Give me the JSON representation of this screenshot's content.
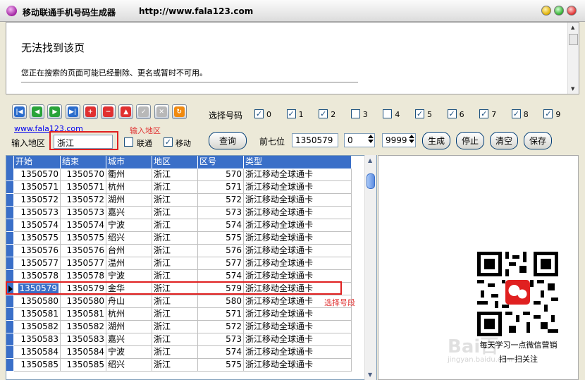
{
  "window": {
    "title": "移动联通手机号码生成器",
    "url": "http://www.fala123.com"
  },
  "web": {
    "heading": "无法找到该页",
    "message": "您正在搜索的页面可能已经删除、更名或暂时不可用。"
  },
  "toolbar": {
    "icons": [
      "first-icon",
      "prev-icon",
      "play-icon",
      "next-icon",
      "add-icon",
      "remove-icon",
      "up-icon",
      "check-icon",
      "clear-icon",
      "refresh-icon"
    ],
    "icon_glyphs": [
      "|◀",
      "◀",
      "▶",
      "▶|",
      "+",
      "−",
      "▲",
      "✓",
      "✕",
      "↻"
    ]
  },
  "select_number": {
    "label": "选择号码",
    "digits": [
      {
        "label": "0",
        "checked": true
      },
      {
        "label": "1",
        "checked": true
      },
      {
        "label": "2",
        "checked": true
      },
      {
        "label": "3",
        "checked": false
      },
      {
        "label": "4",
        "checked": false
      },
      {
        "label": "5",
        "checked": true
      },
      {
        "label": "6",
        "checked": true
      },
      {
        "label": "7",
        "checked": true
      },
      {
        "label": "8",
        "checked": true
      },
      {
        "label": "9",
        "checked": true
      }
    ]
  },
  "link": "www.fala123.com",
  "annotations": {
    "input_region": "输入地区",
    "select_segment": "选择号段"
  },
  "form": {
    "region_label": "输入地区",
    "region_value": "浙江",
    "unicom_label": "联通",
    "unicom_checked": false,
    "mobile_label": "移动",
    "mobile_checked": true,
    "query_button": "查询",
    "first7_label": "前七位",
    "first7_value": "1350579",
    "start_value": "0",
    "end_value": "9999",
    "generate_button": "生成",
    "stop_button": "停止",
    "clear_button": "清空",
    "save_button": "保存"
  },
  "table": {
    "columns": [
      "开始",
      "结束",
      "城市",
      "地区",
      "区号",
      "类型"
    ],
    "selected_row": 9,
    "rows": [
      [
        "1350570",
        "1350570",
        "衢州",
        "浙江",
        "570",
        "浙江移动全球通卡"
      ],
      [
        "1350571",
        "1350571",
        "杭州",
        "浙江",
        "571",
        "浙江移动全球通卡"
      ],
      [
        "1350572",
        "1350572",
        "湖州",
        "浙江",
        "572",
        "浙江移动全球通卡"
      ],
      [
        "1350573",
        "1350573",
        "嘉兴",
        "浙江",
        "573",
        "浙江移动全球通卡"
      ],
      [
        "1350574",
        "1350574",
        "宁波",
        "浙江",
        "574",
        "浙江移动全球通卡"
      ],
      [
        "1350575",
        "1350575",
        "绍兴",
        "浙江",
        "575",
        "浙江移动全球通卡"
      ],
      [
        "1350576",
        "1350576",
        "台州",
        "浙江",
        "576",
        "浙江移动全球通卡"
      ],
      [
        "1350577",
        "1350577",
        "温州",
        "浙江",
        "577",
        "浙江移动全球通卡"
      ],
      [
        "1350578",
        "1350578",
        "宁波",
        "浙江",
        "574",
        "浙江移动全球通卡"
      ],
      [
        "1350579",
        "1350579",
        "金华",
        "浙江",
        "579",
        "浙江移动全球通卡"
      ],
      [
        "1350580",
        "1350580",
        "舟山",
        "浙江",
        "580",
        "浙江移动全球通卡"
      ],
      [
        "1350581",
        "1350581",
        "杭州",
        "浙江",
        "571",
        "浙江移动全球通卡"
      ],
      [
        "1350582",
        "1350582",
        "湖州",
        "浙江",
        "572",
        "浙江移动全球通卡"
      ],
      [
        "1350583",
        "1350583",
        "嘉兴",
        "浙江",
        "573",
        "浙江移动全球通卡"
      ],
      [
        "1350584",
        "1350584",
        "宁波",
        "浙江",
        "574",
        "浙江移动全球通卡"
      ],
      [
        "1350585",
        "1350585",
        "绍兴",
        "浙江",
        "575",
        "浙江移动全球通卡"
      ]
    ]
  },
  "qr": {
    "line1": "每天学习一点微信营销",
    "line2": "扫一扫关注"
  },
  "watermark": {
    "brand": "Bai百",
    "domain": "jingyan.baidu.com"
  },
  "colors": {
    "accent": "#3a6fc8",
    "annotation": "#e02020"
  }
}
